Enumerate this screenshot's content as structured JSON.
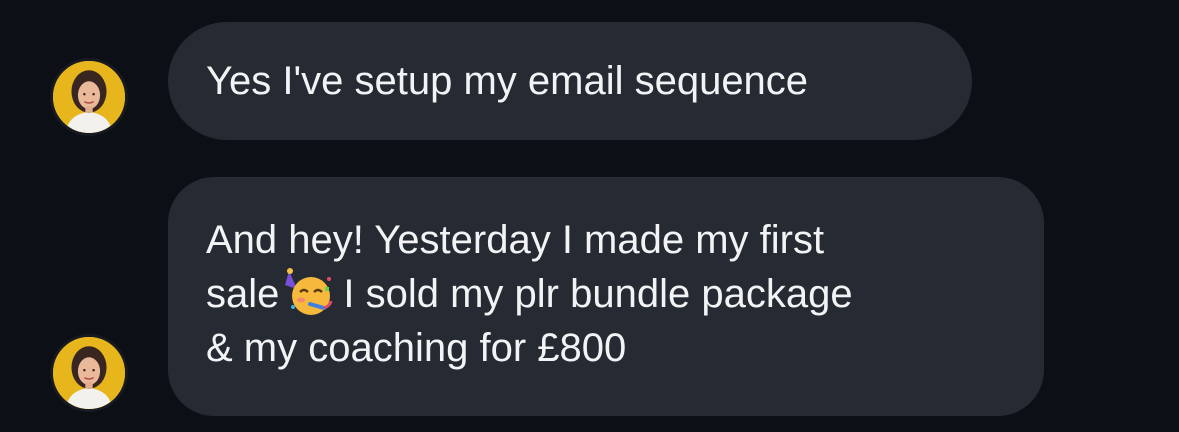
{
  "messages": [
    {
      "sender_avatar": "woman-avatar",
      "text": "Yes I've setup my email sequence"
    },
    {
      "sender_avatar": "woman-avatar",
      "line1": "And hey! Yesterday I made my first",
      "line2_before": "sale",
      "emoji": "partying-face-icon",
      "line2_after": "I sold my plr bundle package",
      "line3": "& my coaching for £800"
    }
  ],
  "colors": {
    "background": "#0c0f16",
    "bubble": "#262a33",
    "text": "#f2f3f5",
    "avatar_bg": "#e7b51c"
  }
}
